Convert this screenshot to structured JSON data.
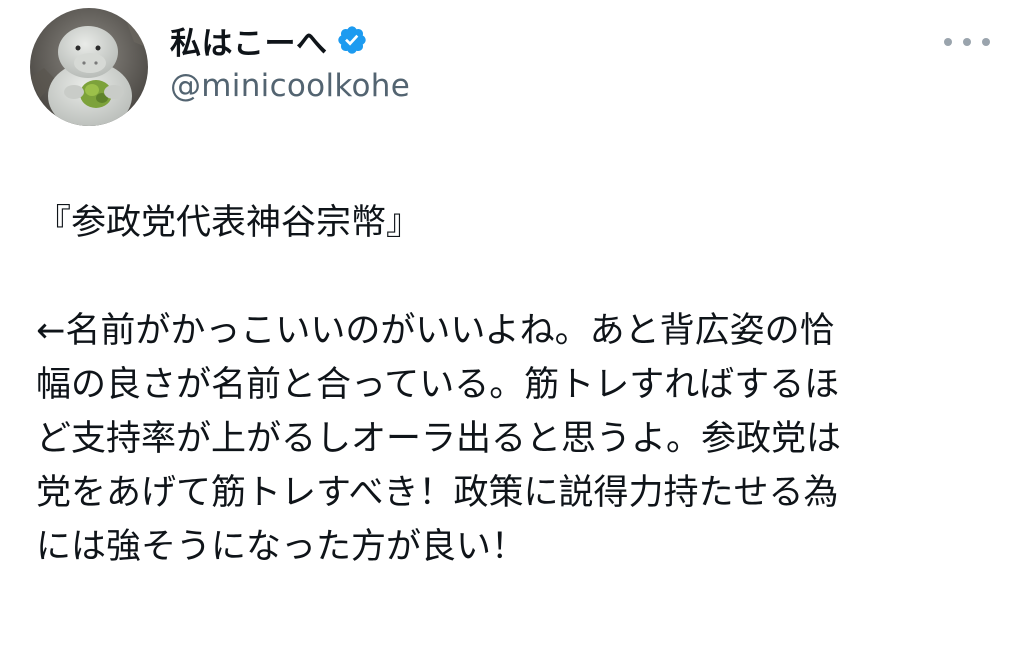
{
  "user": {
    "display_name": "私はこーへ",
    "handle": "@minicoolkohe",
    "avatar_icon": "manatee-plush-avatar",
    "verified_icon": "verified-badge-icon"
  },
  "menu": {
    "more_icon": "more-options-icon"
  },
  "tweet": {
    "lines": [
      "『参政党代表神谷宗幣』",
      "",
      "←名前がかっこいいのがいいよね。あと背広姿の恰",
      "幅の良さが名前と合っている。筋トレすればするほ",
      "ど支持率が上がるしオーラ出ると思うよ。参政党は",
      "党をあげて筋トレすべき！政策に説得力持たせる為",
      "には強そうになった方が良い！"
    ]
  },
  "colors": {
    "text": "#0f1419",
    "secondary": "#536471",
    "verified_blue": "#1d9bf0",
    "background": "#ffffff"
  }
}
